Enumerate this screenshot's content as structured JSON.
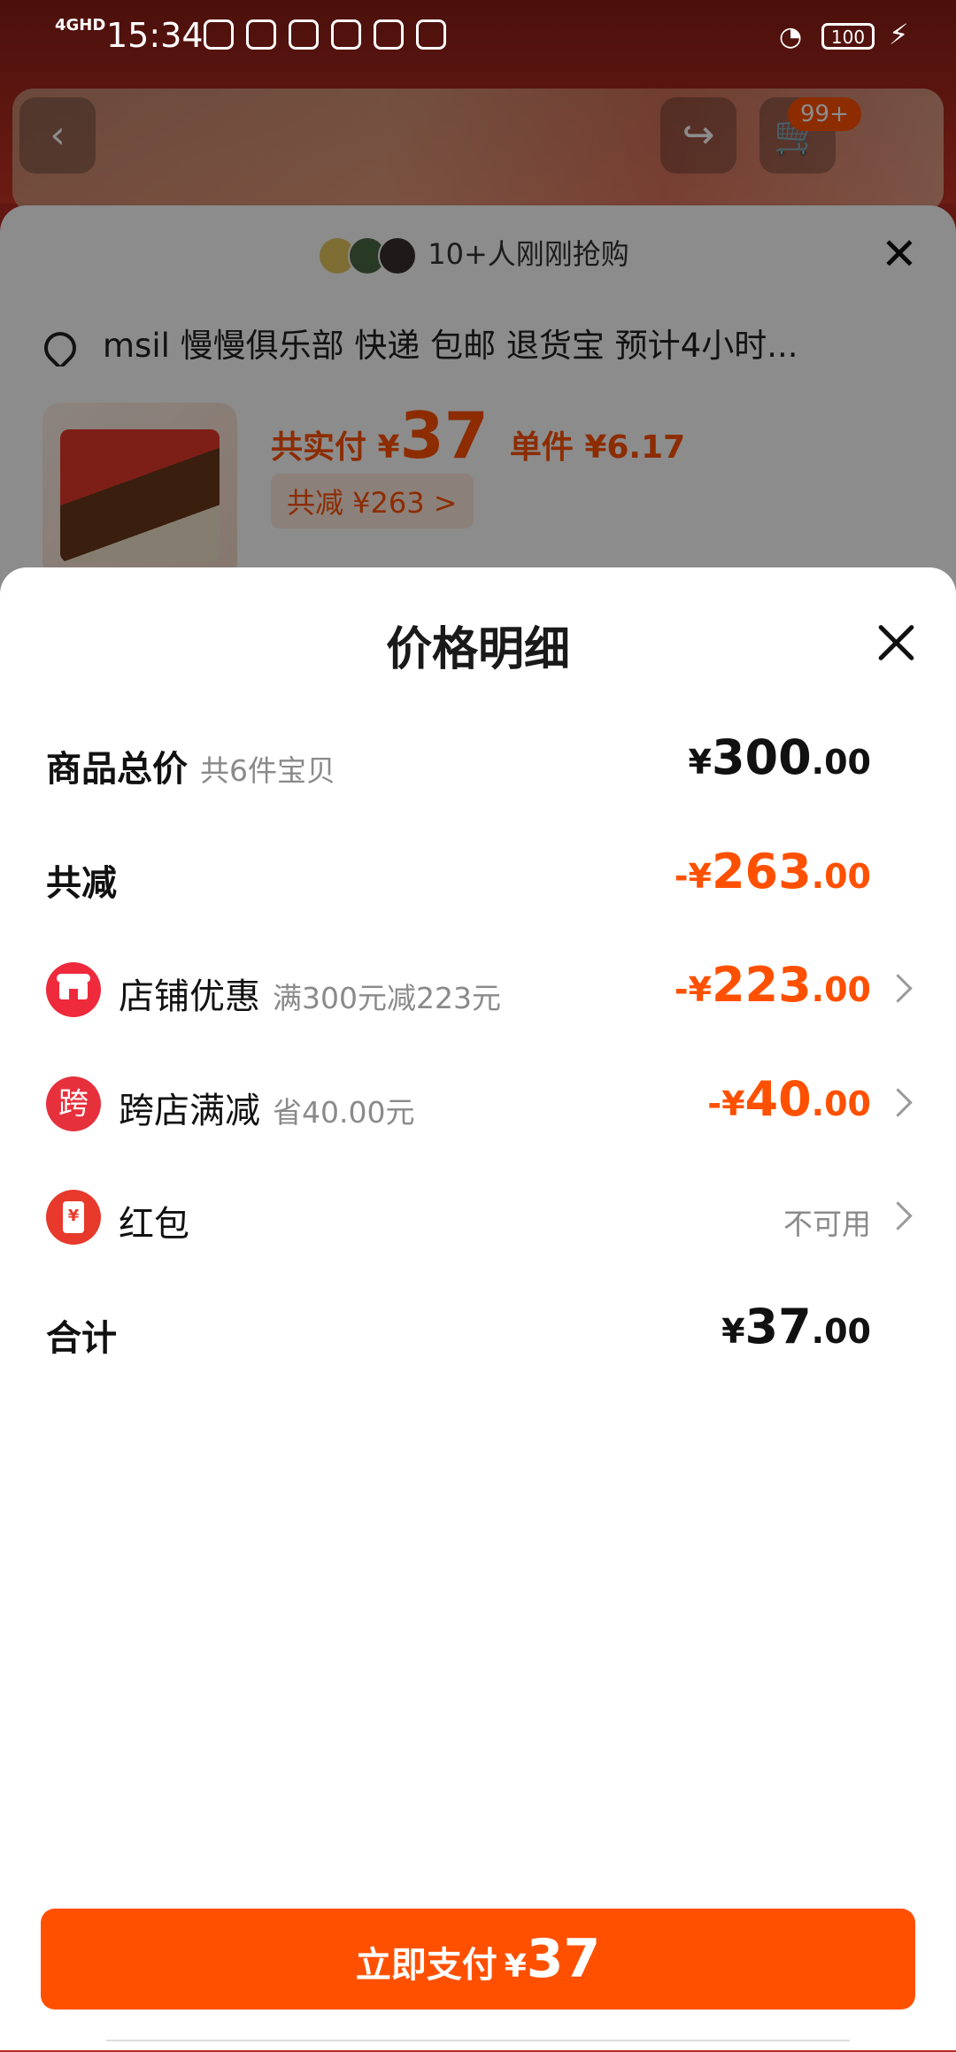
{
  "status_bar": {
    "network": "4GHD",
    "time": "15:34",
    "battery": "100"
  },
  "background": {
    "cart_badge": "99+",
    "buyers_text": "10+人刚刚抢购",
    "address": "msil 慢慢俱乐部  快递 包邮 退货宝 预计4小时...",
    "price_label": "共实付 ¥",
    "price_value": "37",
    "unit_price": "单件 ¥6.17",
    "discount_tag": "共减 ¥263 >"
  },
  "sheet": {
    "title": "价格明细",
    "rows": {
      "total": {
        "label": "商品总价",
        "sub": "共6件宝贝",
        "currency": "¥",
        "int": "300",
        "dec": ".00"
      },
      "reduction": {
        "label": "共减",
        "currency": "-¥",
        "int": "263",
        "dec": ".00"
      },
      "store": {
        "label": "店铺优惠",
        "sub": "满300元减223元",
        "currency": "-¥",
        "int": "223",
        "dec": ".00"
      },
      "cross": {
        "label": "跨店满减",
        "sub": "省40.00元",
        "icon_char": "跨",
        "currency": "-¥",
        "int": "40",
        "dec": ".00"
      },
      "redpacket": {
        "label": "红包",
        "status": "不可用"
      },
      "sum": {
        "label": "合计",
        "currency": "¥",
        "int": "37",
        "dec": ".00"
      }
    }
  },
  "pay_button": {
    "label": "立即支付",
    "currency": "¥",
    "amount": "37"
  },
  "colors": {
    "accent": "#ff5000",
    "badge_red": "#ee2a3c"
  },
  "icons": [
    "back-icon",
    "share-icon",
    "cart-icon",
    "close-icon",
    "location-pin-icon",
    "store-icon",
    "cross-store-icon",
    "red-packet-icon",
    "chevron-right-icon"
  ]
}
